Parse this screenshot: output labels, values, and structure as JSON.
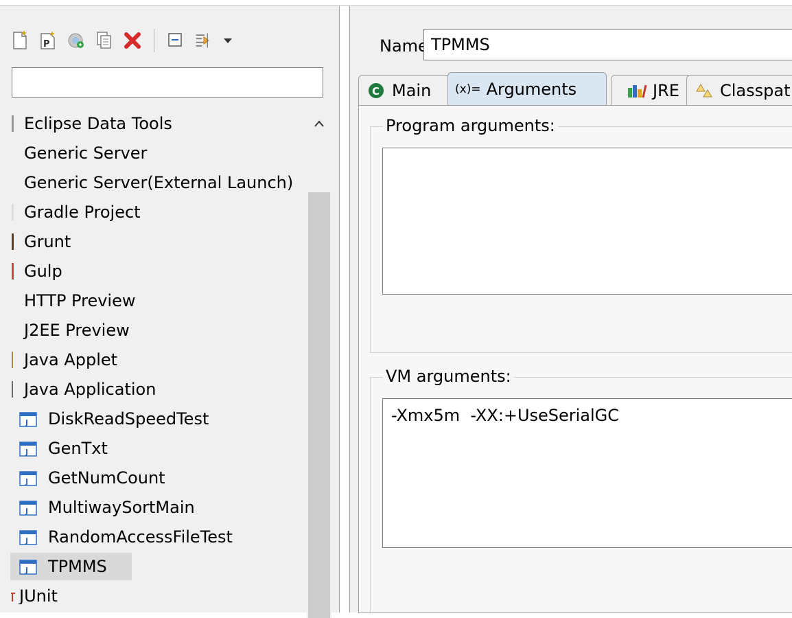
{
  "filter": {
    "value": "",
    "placeholder": ""
  },
  "toolbar": {
    "buttons": [
      "new-launch-configuration-icon",
      "new-prototype-icon",
      "export-icon",
      "duplicate-icon",
      "delete-icon",
      "collapse-all-icon",
      "filter-icon"
    ]
  },
  "tree": {
    "items": [
      {
        "label": "Eclipse Data Tools",
        "mark": "#999999"
      },
      {
        "label": "Generic Server",
        "mark": ""
      },
      {
        "label": "Generic Server(External Launch)",
        "mark": ""
      },
      {
        "label": "Gradle Project",
        "mark": "#dddddd"
      },
      {
        "label": "Grunt",
        "mark": "#5a3e28"
      },
      {
        "label": "Gulp",
        "mark": "#cf4647"
      },
      {
        "label": "HTTP Preview",
        "mark": ""
      },
      {
        "label": "J2EE Preview",
        "mark": ""
      },
      {
        "label": "Java Applet",
        "mark": "#b08a3c"
      },
      {
        "label": "Java Application",
        "mark": "#6b6b6b"
      },
      {
        "label": "DiskReadSpeedTest"
      },
      {
        "label": "GenTxt"
      },
      {
        "label": "GetNumCount"
      },
      {
        "label": "MultiwaySortMain"
      },
      {
        "label": "RandomAccessFileTest"
      },
      {
        "label": "TPMMS"
      },
      {
        "label": "JUnit",
        "mark": "#c0392b"
      }
    ]
  },
  "config": {
    "name_label": "Name:",
    "name_value": "TPMMS",
    "tabs": {
      "main": "Main",
      "arguments": "Arguments",
      "arguments_prefix": "(x)=",
      "jre": "JRE",
      "classpath": "Classpat"
    },
    "program_args_label": "Program arguments:",
    "program_args_value": "",
    "vm_args_label": "VM arguments:",
    "vm_args_value": "-Xmx5m  -XX:+UseSerialGC"
  },
  "colors": {
    "accent": "#2e6fc4",
    "selected": "#d9d9d9",
    "main_tab_icon": "#1e7a3c",
    "delete_icon": "#d82c2c"
  }
}
